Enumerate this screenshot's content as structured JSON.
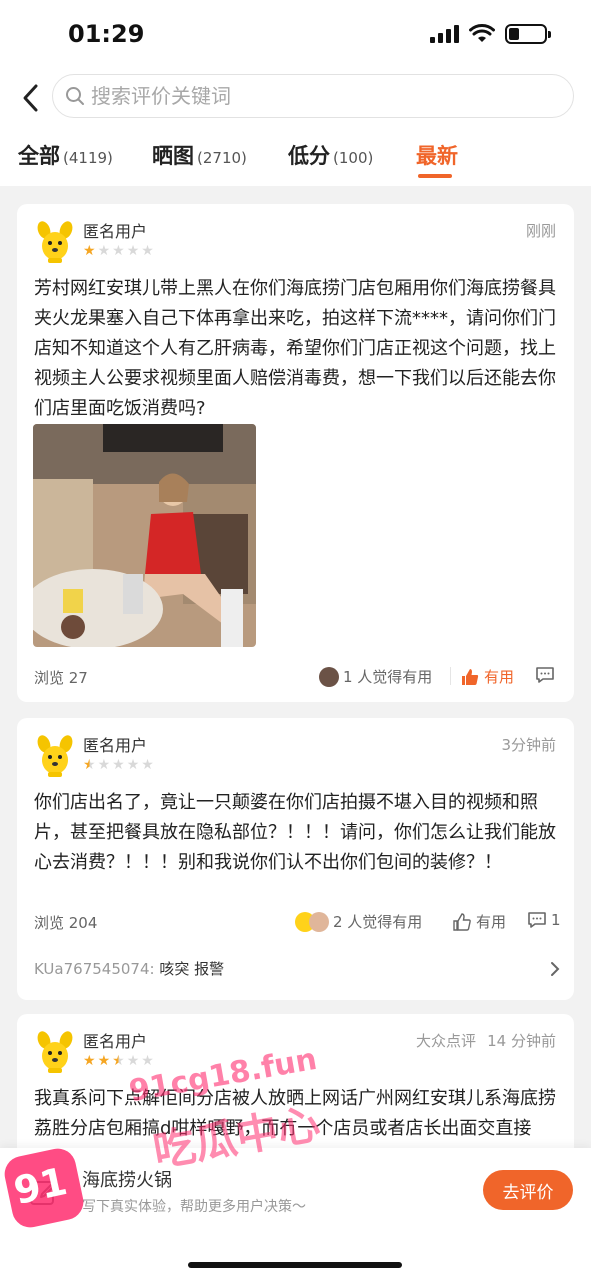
{
  "status": {
    "time": "01:29"
  },
  "search": {
    "placeholder": "搜索评价关键词"
  },
  "tabs": [
    {
      "label": "全部",
      "count": "(4119)"
    },
    {
      "label": "晒图",
      "count": "(2710)"
    },
    {
      "label": "低分",
      "count": "(100)"
    },
    {
      "label": "最新",
      "count": ""
    }
  ],
  "reviews": [
    {
      "user": "匿名用户",
      "rating": 1,
      "time": "刚刚",
      "text": "芳村网红安琪儿带上黑人在你们海底捞门店包厢用你们海底捞餐具夹火龙果塞入自己下体再拿出来吃，拍这样下流****，请问你们门店知不知道这个人有乙肝病毒，希望你们门店正视这个问题，找上视频主人公要求视频里面人赔偿消毒费，想一下我们以后还能去你们店里面吃饭消费吗?",
      "views": "浏览 27",
      "useful_count": "1 人觉得有用",
      "useful_label": "有用"
    },
    {
      "user": "匿名用户",
      "rating": 0.5,
      "time": "3分钟前",
      "text": "你们店出名了，竟让一只颠婆在你们店拍摄不堪入目的视频和照片，甚至把餐具放在隐私部位？！！！请问，你们怎么让我们能放心去消费？！！！别和我说你们认不出你们包间的装修？！",
      "views": "浏览 204",
      "useful_count": "2 人觉得有用",
      "useful_label": "有用",
      "comment_count": "1",
      "reply_user": "KUa767545074:",
      "reply_text": "咳突 报警"
    },
    {
      "user": "匿名用户",
      "rating": 2.5,
      "source": "大众点评",
      "time": "14 分钟前",
      "text": "我真系问下点解佢间分店被人放晒上网话广州网红安琪儿系海底捞荔胜分店包厢搞d咁样嘎野，而冇一个店员或者店长出面交直接佢？咁你店装有监控都有用，就识西海底捞连"
    }
  ],
  "bottom_bar": {
    "title": "海底捞火锅",
    "subtitle": "写下真实体验，帮助更多用户决策～",
    "button": "去评价"
  },
  "watermark": {
    "badge": "91",
    "site": "91cg18.fun",
    "slogan": "吃瓜中心"
  },
  "colors": {
    "accent": "#f0652a",
    "star": "#f5a623"
  }
}
